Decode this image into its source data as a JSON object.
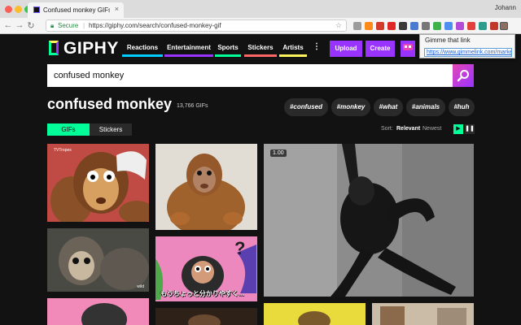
{
  "browser": {
    "tab_title": "Confused monkey GIFs - Find",
    "tab_close": "×",
    "profile_name": "Johann",
    "secure_label": "Secure",
    "url": "https://giphy.com/search/confused-monkey-gif"
  },
  "header": {
    "logo_text": "GIPHY",
    "nav": [
      {
        "label": "Reactions",
        "color": "#00ccff"
      },
      {
        "label": "Entertainment",
        "color": "#9933ff"
      },
      {
        "label": "Sports",
        "color": "#00ff99"
      },
      {
        "label": "Stickers",
        "color": "#ff6666"
      },
      {
        "label": "Artists",
        "color": "#fff35c"
      }
    ],
    "more": "⋮",
    "upload_label": "Upload",
    "create_label": "Create"
  },
  "extension_popup": {
    "title": "Gimme that link",
    "link": "https://www.gimmelink.com/market"
  },
  "search": {
    "value": "confused monkey"
  },
  "results": {
    "title": "confused monkey",
    "count": "13,766 GIFs",
    "tags": [
      "#confused",
      "#monkey",
      "#what",
      "#animals",
      "#huh"
    ]
  },
  "filters": {
    "gifs_label": "GIFs",
    "stickers_label": "Stickers",
    "sort_label": "Sort:",
    "sort_relevant": "Relevant",
    "sort_newest": "Newest"
  },
  "gifs": {
    "badge": "1.00",
    "japanese_caption": "もうちょっと分かりやすく...",
    "tvtropes_wm": "TVTropes",
    "wild_wm": "wild"
  },
  "colors": {
    "accent_green": "#00ff99",
    "accent_purple": "#9933ff",
    "background": "#121212"
  }
}
